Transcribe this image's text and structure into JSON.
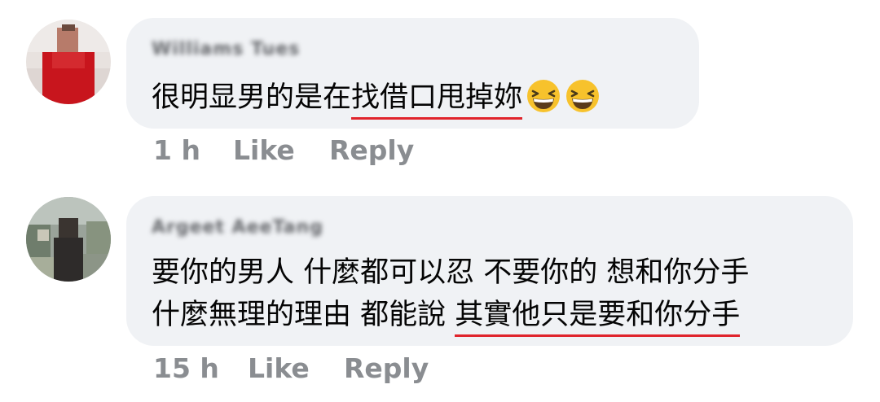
{
  "comments": [
    {
      "author": "Williams Tues",
      "lines": [
        {
          "plain": "很明显男的是在",
          "underlined": "找借口甩掉妳",
          "emoji_count": 2
        }
      ],
      "emoji_icon": "grinning-squinting-face-icon",
      "time": "1 h",
      "like_label": "Like",
      "reply_label": "Reply",
      "avatar_color": "#c8151d"
    },
    {
      "author": "Argeet AeeTang",
      "lines": [
        {
          "plain": "要你的男人 什麼都可以忍 不要你的 想和你分手"
        },
        {
          "plain": "什麼無理的理由 都能說 ",
          "underlined": "其實他只是要和你分手"
        }
      ],
      "time": "15 h",
      "like_label": "Like",
      "reply_label": "Reply"
    }
  ],
  "colors": {
    "bubble_bg": "#f0f2f5",
    "underline": "#e0242c",
    "meta_text": "#8a8d91"
  }
}
